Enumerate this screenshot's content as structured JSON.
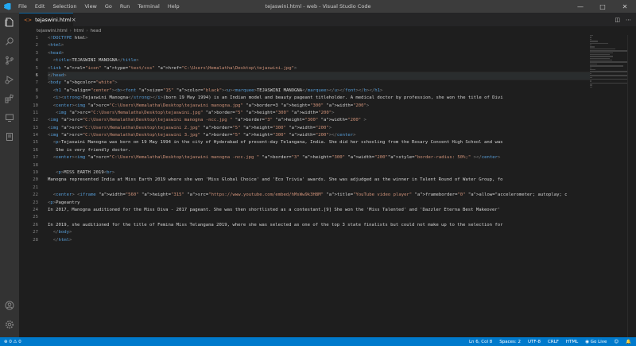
{
  "window": {
    "title": "tejaswini.html - web - Visual Studio Code",
    "menu": [
      "File",
      "Edit",
      "Selection",
      "View",
      "Go",
      "Run",
      "Terminal",
      "Help"
    ]
  },
  "tab": {
    "label": "tejaswini.html",
    "close": "×"
  },
  "breadcrumb": {
    "file": "tejaswini.html",
    "html": "html",
    "head": "head"
  },
  "line_numbers": [
    "1",
    "2",
    "3",
    "4",
    "5",
    "6",
    "7",
    "8",
    "9",
    "10",
    "11",
    "12",
    "13",
    "14",
    "15",
    "16",
    "17",
    "18",
    "19",
    "20",
    "21",
    "22",
    "23",
    "24",
    "25",
    "26",
    "27",
    "28"
  ],
  "code_lines": [
    "<!DOCTYPE html>",
    "<html>",
    "<head>",
    "  <title>TEJASWINI MANOGNA</title>",
    "<link rel=\"icon\" type=\"text/css\" href=\"C:\\Users\\Hemalatha\\Desktop\\tejaswini.jpg\">",
    "</head>",
    "<body bgcolor=\"white\">",
    "  <h1 align=\"center\"><b><font size=\"15\" color=\"black\"><u><marquee>TEJASWINI MANOGNA</marquee></u></font></b></h1>",
    "  <i><strong>Tejaswini Manogna</strong></i>(born 19 May 1994) is an Indian model and beauty pageant titleholder. A medical doctor by profession, she won the title of Divi",
    "  <center><img src=\"C:\\Users\\Hemalatha\\Desktop\\tejaswini manogna.jpg\" border=3 height=\"300\" width=\"200\">",
    "   <img src=\"C:\\Users\\Hemalatha\\Desktop\\tejaswini.jpg\" border=\"5\" height=\"300\" width=\"200\">",
    "<img src=\"C:\\Users\\Hemalatha\\Desktop\\tejaswini manogna -ncc.jpg \" border=\"3\" height=\"300\" width=\"200\" >",
    "<img src=\"C:\\Users\\Hemalatha\\Desktop\\tejaswini 2.jpg\" border=\"5\" height=\"300\" width=\"200\">",
    "<img src=\"C:\\Users\\Hemalatha\\Desktop\\tejaswini 3.jpg\" border=\"5\" height=\"300\" width=\"200\"></center>",
    "  <p>Tejaswini Manogna was born on 19 May 1994 in the city of Hyderabad of present-day Telangana, India. She did her schooling from the Rosary Convent High School and was",
    "   She is very friendly doctor.",
    "  <center><img src=\"C:\\Users\\Hemalatha\\Desktop\\tejaswini manogna -ncc.jpg \" border=\"3\" height=\"300\" width=\"200\"style=\"border-radius: 50%;\" ></center>",
    "",
    "   <p>MISS EARTH 2019<br>",
    "Manogna represented India at Miss Earth 2019 where she won 'Miss Global Choice' and 'Eco Trivia' awards. She was adjudged as the winner in Talent Round of Water Group, fo",
    "",
    "  <center> <iframe width=\"560\" height=\"315\" src=\"https://www.youtube.com/embed/hMsWw9k3H8M\" title=\"YouTube video player\" frameborder=\"0\" allow=\"accelerometer; autoplay; c",
    "<p>Pageantry",
    "In 2017, Manogna auditioned for the Miss Diva - 2017 pageant. She was then shortlisted as a contestant.[9] She won the 'Miss Talented' and 'Dazzler Eterna Best Makeover'",
    "",
    "In 2019, she auditioned for the title of Femina Miss Telangana 2019, where she was selected as one of the top 3 state finalists but could not make up to the selection for",
    "  </body>",
    "  </html>"
  ],
  "status": {
    "errors": "0",
    "warnings": "0",
    "position": "Ln 6, Col 8",
    "spaces": "Spaces: 2",
    "encoding": "UTF-8",
    "eol": "CRLF",
    "language": "HTML",
    "golive": "Go Live"
  },
  "colors": {
    "accent": "#007acc",
    "tag": "#569cd6",
    "attr": "#9cdcfe",
    "string": "#ce9178"
  }
}
